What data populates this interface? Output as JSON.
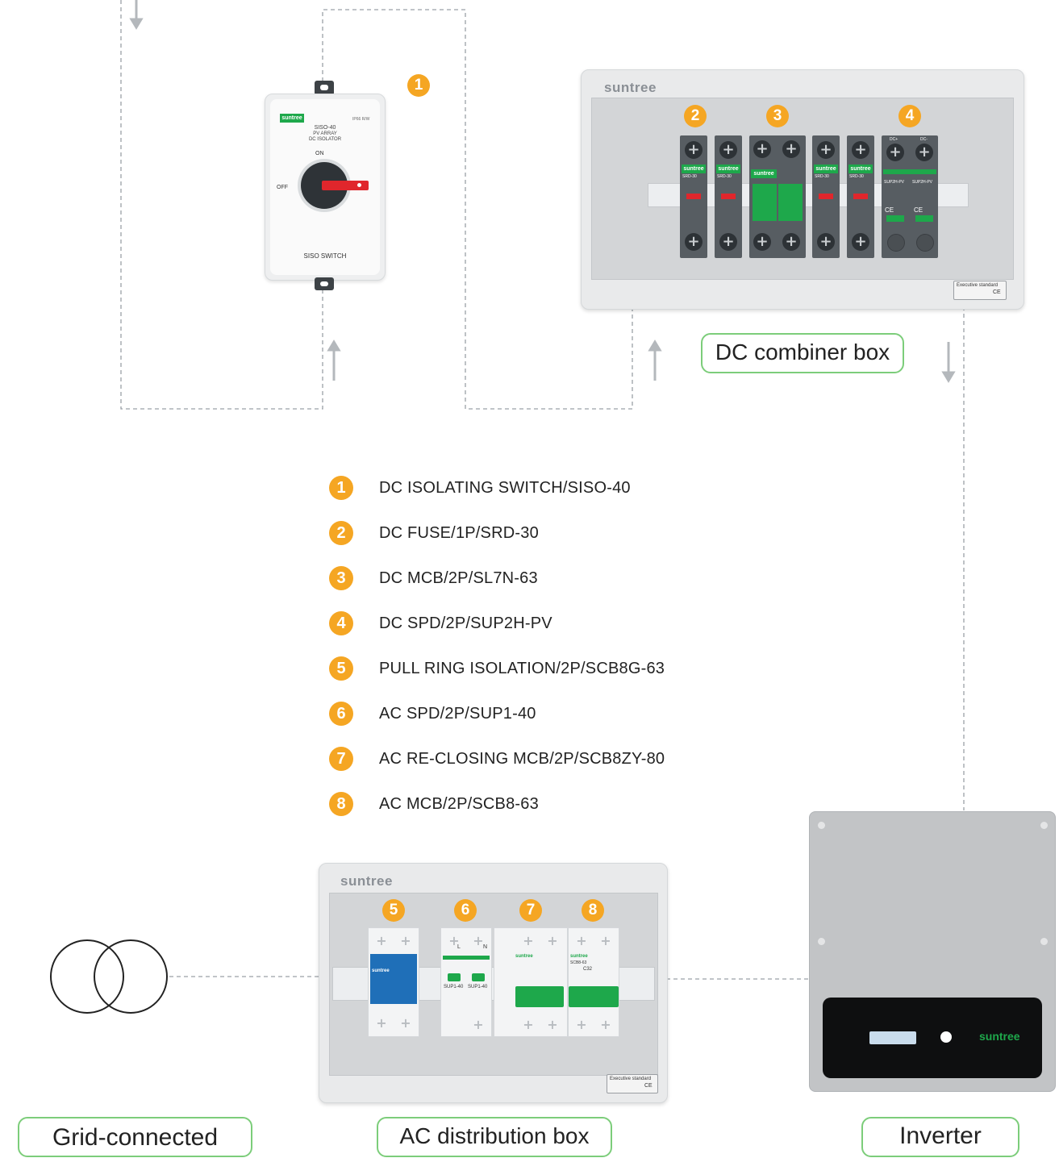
{
  "brand": "suntree",
  "siso_switch": {
    "badge": "1",
    "brand": "suntree",
    "model": "SISO-40",
    "line2": "PV ARRAY",
    "line3": "DC ISOLATOR",
    "rating": "IP66 R/W",
    "on": "ON",
    "off": "OFF",
    "name": "SISO SWITCH"
  },
  "dc_combiner": {
    "brand": "suntree",
    "badges": [
      "2",
      "3",
      "4"
    ],
    "fuse_model": "SRD-30",
    "spd_model": "SUP2H-PV",
    "spd_terminals": [
      "DC+",
      "DC-"
    ],
    "ce": "CE",
    "standard_label": "Executive standard",
    "label": "DC combiner box"
  },
  "legend": [
    {
      "num": "1",
      "text": "DC ISOLATING SWITCH/SISO-40"
    },
    {
      "num": "2",
      "text": "DC FUSE/1P/SRD-30"
    },
    {
      "num": "3",
      "text": "DC MCB/2P/SL7N-63"
    },
    {
      "num": "4",
      "text": "DC SPD/2P/SUP2H-PV"
    },
    {
      "num": "5",
      "text": "PULL RING ISOLATION/2P/SCB8G-63"
    },
    {
      "num": "6",
      "text": "AC SPD/2P/SUP1-40"
    },
    {
      "num": "7",
      "text": "AC RE-CLOSING MCB/2P/SCB8ZY-80"
    },
    {
      "num": "8",
      "text": "AC MCB/2P/SCB8-63"
    }
  ],
  "ac_box": {
    "brand": "suntree",
    "badges": [
      "5",
      "6",
      "7",
      "8"
    ],
    "spd_model": "SUP1-40",
    "spd_terminals": [
      "L",
      "N"
    ],
    "mcb_model": "SCB8-63",
    "mcb_rating": "C32",
    "standard_label": "Executive standard",
    "label": "AC distribution box"
  },
  "inverter": {
    "brand": "suntree",
    "label": "Inverter"
  },
  "grid": {
    "label": "Grid-connected"
  },
  "colors": {
    "accent_orange": "#f5a623",
    "label_border_green": "#7ccd7a",
    "device_green": "#1ea84b",
    "spd_blue": "#1f6fb8"
  }
}
